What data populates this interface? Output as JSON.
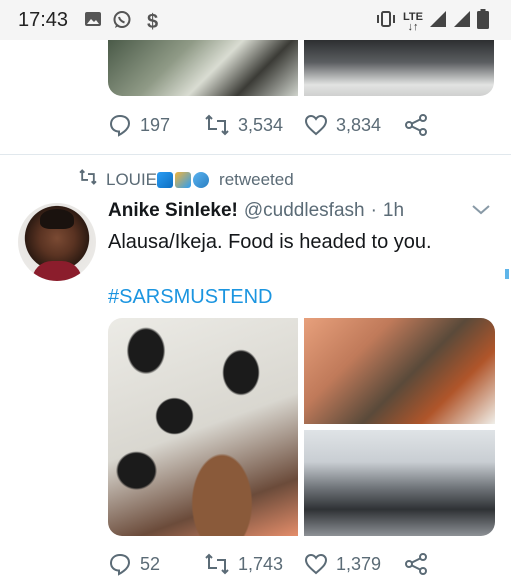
{
  "status_bar": {
    "time": "17:43",
    "network": "LTE",
    "left_icons": [
      "image-icon",
      "whatsapp-icon",
      "dollar-icon"
    ],
    "right_icons": [
      "vibrate-icon",
      "lte-icon",
      "signal-icon",
      "signal-icon",
      "battery-icon"
    ]
  },
  "tweet_prev": {
    "replies": "197",
    "retweets": "3,534",
    "likes": "3,834"
  },
  "tweet": {
    "retweeter": "LOUIE",
    "retweeted_label": "retweeted",
    "name": "Anike Sinleke!",
    "handle": "@cuddlesfash",
    "separator": "·",
    "age": "1h",
    "text": "Alausa/Ikeja. Food is headed to you.",
    "hashtag": "#SARSMUSTEND",
    "replies": "52",
    "retweets": "1,743",
    "likes": "1,379"
  },
  "colors": {
    "accent": "#1b95e0",
    "muted": "#5b6b76",
    "text": "#14171a",
    "divider": "#e1e8ed"
  }
}
